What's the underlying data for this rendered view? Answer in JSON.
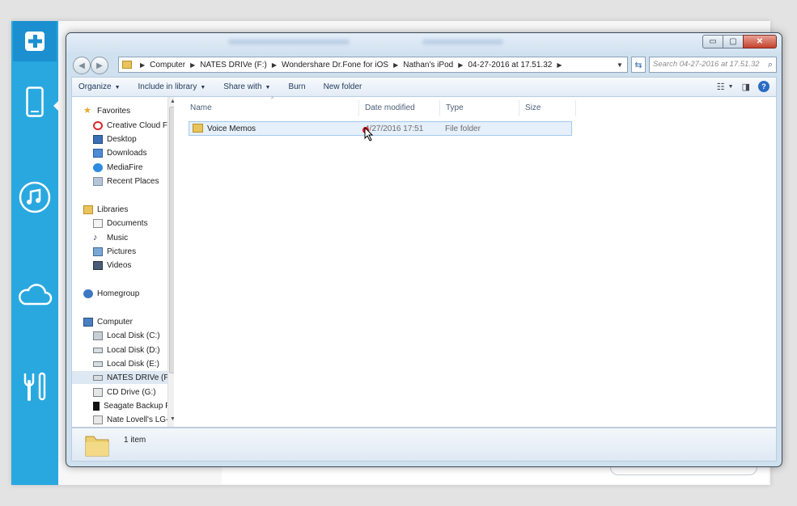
{
  "window": {
    "controls": {
      "minimize": "▭",
      "maximize": "▢",
      "close": "✕"
    }
  },
  "address": {
    "segments": [
      "Computer",
      "NATES DRIVe (F:)",
      "Wondershare Dr.Fone for iOS",
      "Nathan's iPod",
      "04-27-2016 at 17.51.32"
    ],
    "search_placeholder": "Search 04-27-2016 at 17.51.32"
  },
  "toolbar": {
    "organize": "Organize",
    "include_in_library": "Include in library",
    "share_with": "Share with",
    "burn": "Burn",
    "new_folder": "New folder"
  },
  "nav": {
    "favorites": "Favorites",
    "creative_cloud": "Creative Cloud Fi",
    "desktop": "Desktop",
    "downloads": "Downloads",
    "mediafire": "MediaFire",
    "recent_places": "Recent Places",
    "libraries": "Libraries",
    "documents": "Documents",
    "music": "Music",
    "pictures": "Pictures",
    "videos": "Videos",
    "homegroup": "Homegroup",
    "computer": "Computer",
    "local_c": "Local Disk (C:)",
    "local_d": "Local Disk (D:)",
    "local_e": "Local Disk (E:)",
    "nates_drive": "NATES DRIVe (F:)",
    "cd_drive": "CD Drive (G:)",
    "seagate": "Seagate Backup F",
    "lg": "Nate Lovell's LG-"
  },
  "columns": {
    "name": "Name",
    "date_modified": "Date modified",
    "type": "Type",
    "size": "Size"
  },
  "files": [
    {
      "name": "Voice Memos",
      "date_modified": "4/27/2016 17:51",
      "type": "File folder",
      "size": ""
    }
  ],
  "details": {
    "count": "1 item"
  },
  "colors": {
    "sidebar": "#29a8e0",
    "selection": "#e5f0fb",
    "close_button": "#c4432e"
  }
}
